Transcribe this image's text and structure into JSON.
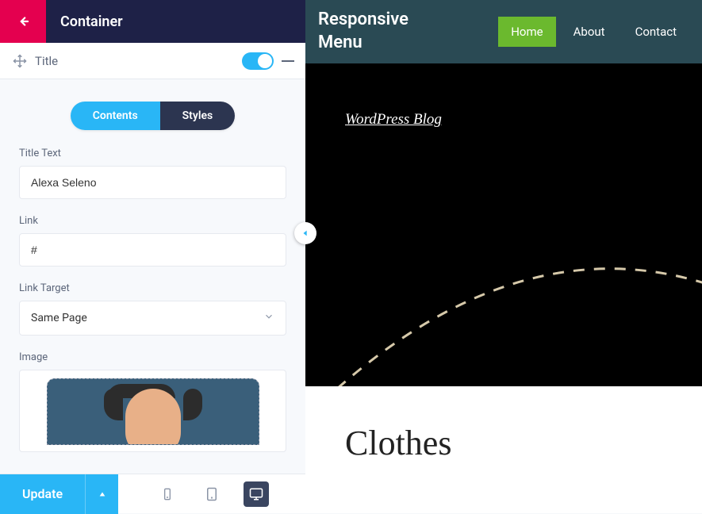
{
  "header": {
    "title": "Container"
  },
  "section": {
    "title": "Title"
  },
  "tabs": {
    "contents": "Contents",
    "styles": "Styles"
  },
  "fields": {
    "titleText": {
      "label": "Title Text",
      "value": "Alexa Seleno"
    },
    "link": {
      "label": "Link",
      "value": "#"
    },
    "linkTarget": {
      "label": "Link Target",
      "selected": "Same Page"
    },
    "image": {
      "label": "Image"
    }
  },
  "footer": {
    "update": "Update"
  },
  "preview": {
    "brand": "Responsive Menu",
    "menu": {
      "home": "Home",
      "about": "About",
      "contact": "Contact"
    },
    "blogLink": "WordPress Blog",
    "heading": "Clothes"
  }
}
